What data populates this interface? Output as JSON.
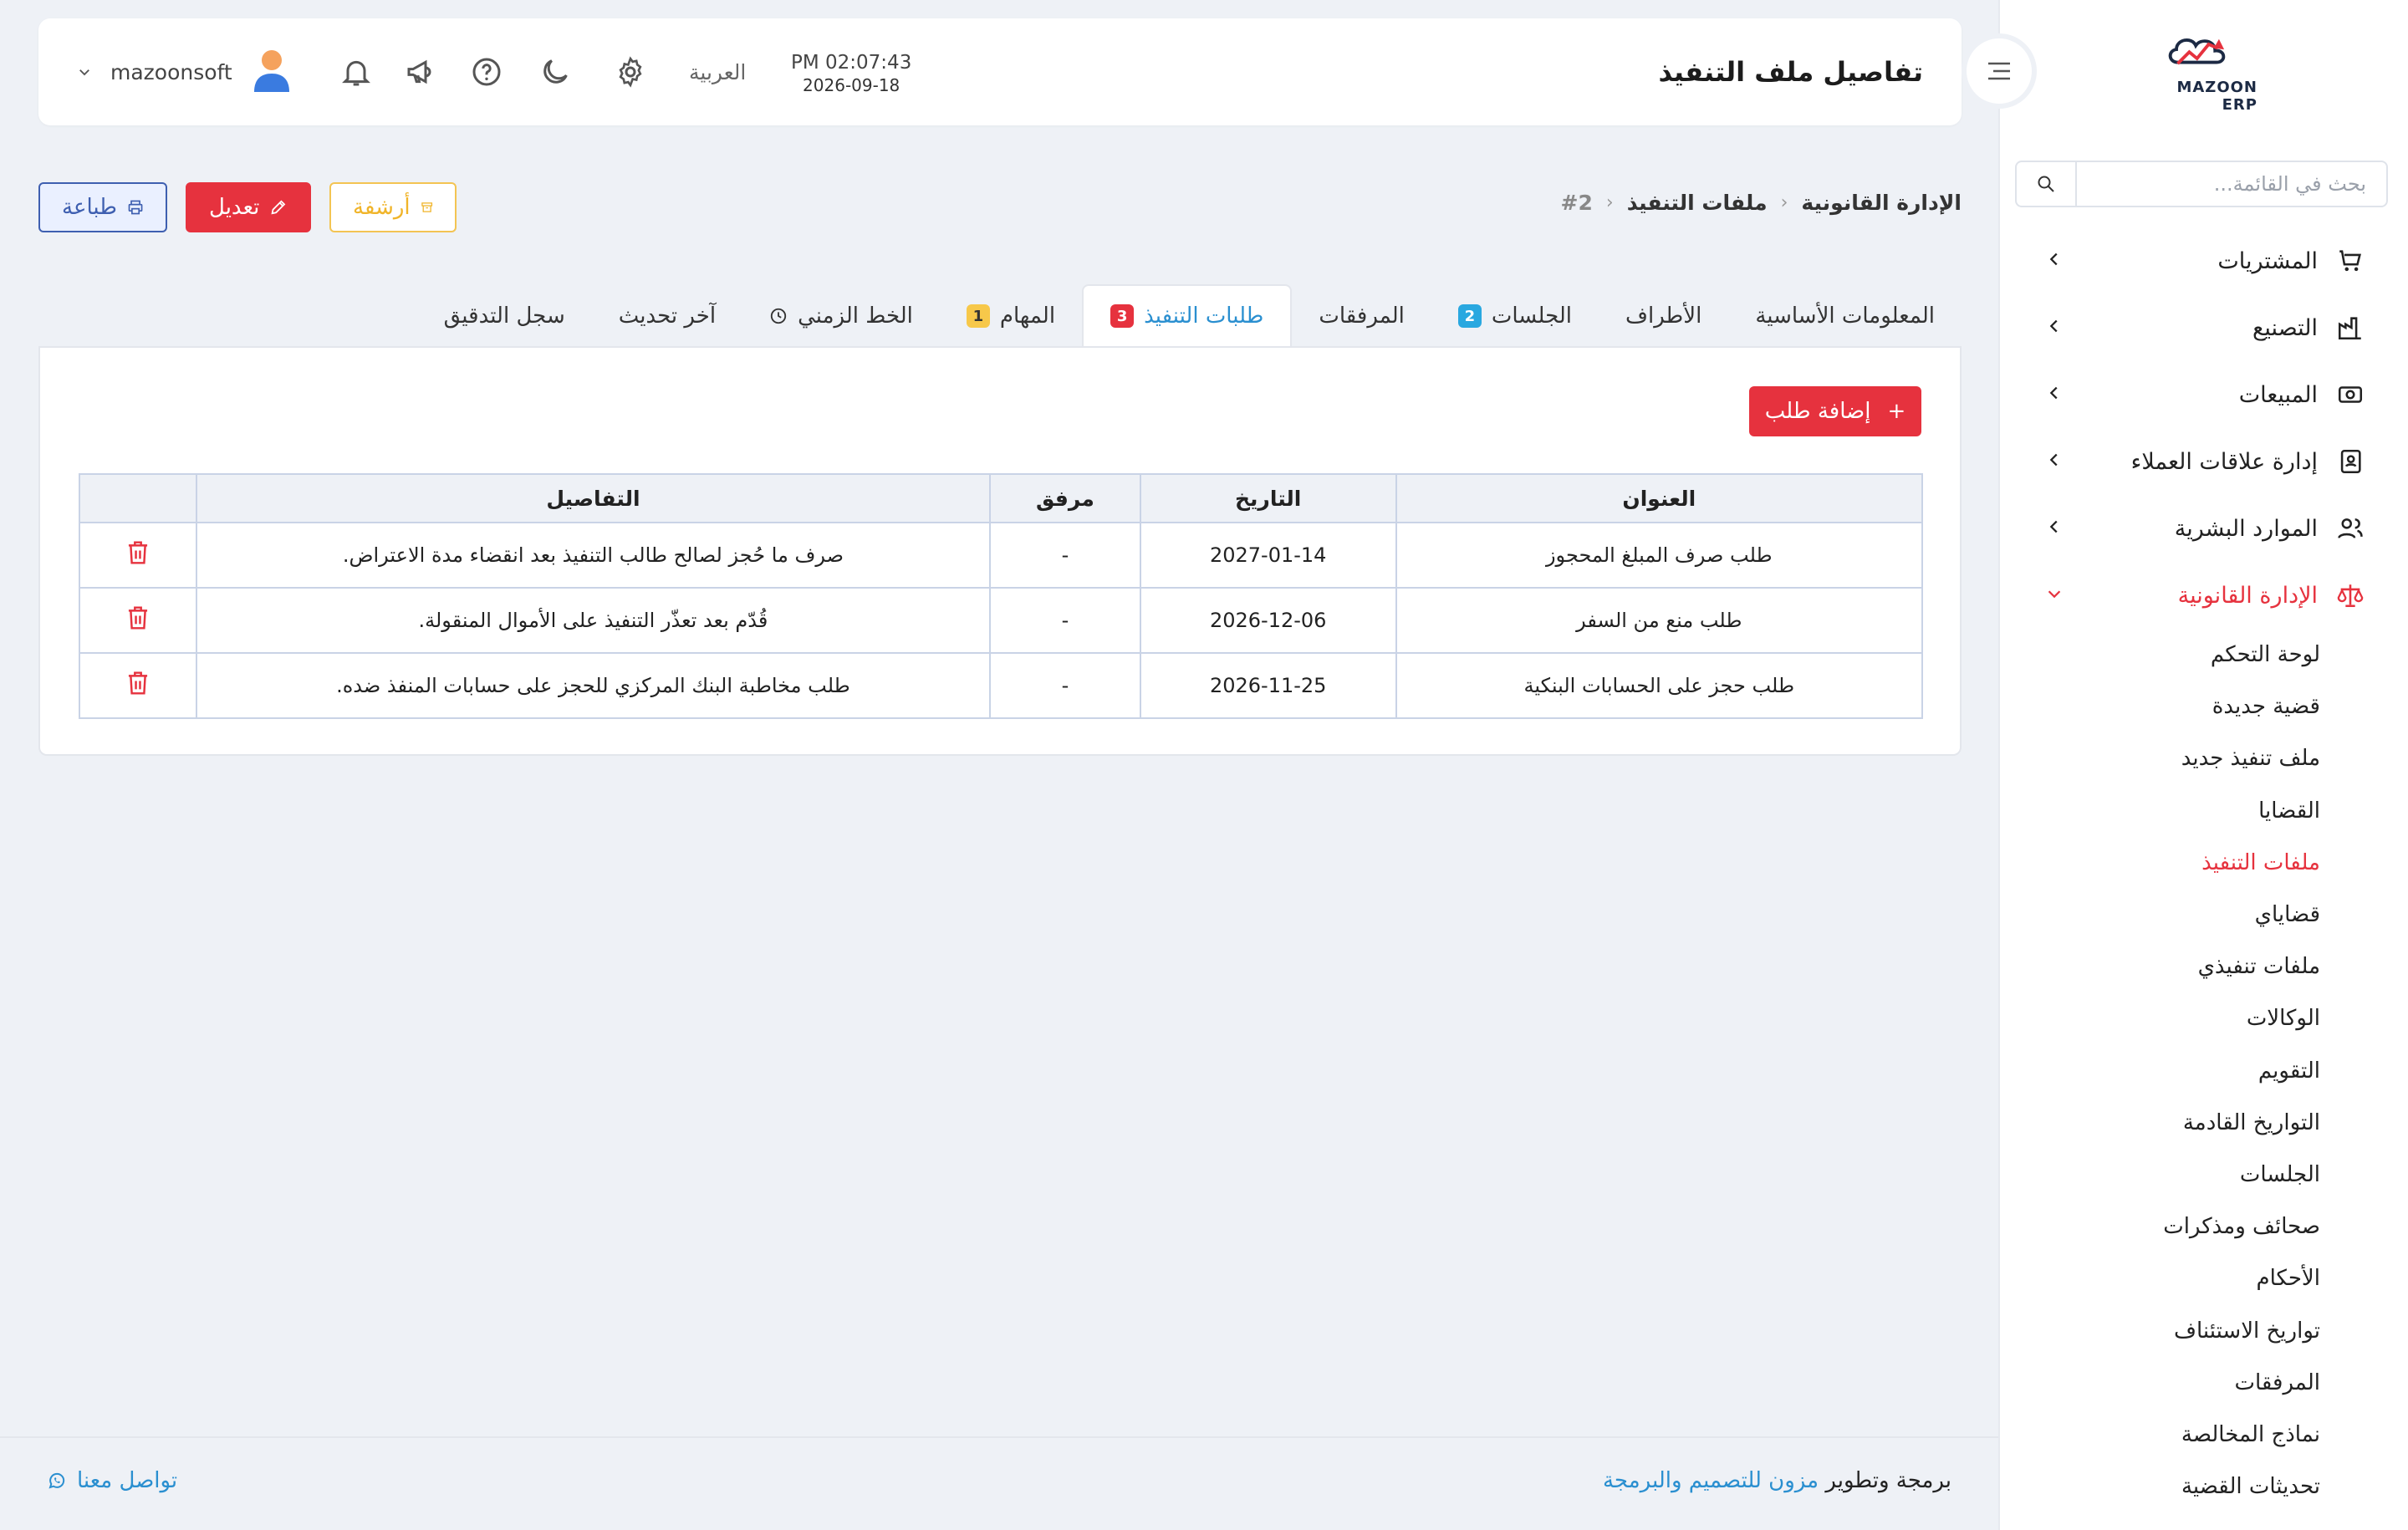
{
  "sidebar": {
    "logo_text": "MAZOON ERP",
    "search_placeholder": "بحث في القائمة...",
    "items": [
      {
        "label": "المشتريات"
      },
      {
        "label": "التصنيع"
      },
      {
        "label": "المبيعات"
      },
      {
        "label": "إدارة علاقات العملاء"
      },
      {
        "label": "الموارد البشرية"
      },
      {
        "label": "الإدارة القانونية"
      }
    ],
    "sub_items": [
      "لوحة التحكم",
      "قضية جديدة",
      "ملف تنفيذ جديد",
      "القضايا",
      "ملفات التنفيذ",
      "قضاياي",
      "ملفات تنفيذي",
      "الوكالات",
      "التقويم",
      "التواريخ القادمة",
      "الجلسات",
      "صحائف ومذكرات",
      "الأحكام",
      "تواريخ الاستئناف",
      "المرفقات",
      "نماذج المخالصة",
      "تحديثات القضية"
    ]
  },
  "header": {
    "title": "تفاصيل ملف التنفيذ",
    "time": "PM 02:07:43",
    "date": "2026-09-18",
    "language": "العربية",
    "username": "mazoonsoft"
  },
  "breadcrumb": {
    "root": "الإدارة القانونية",
    "parent": "ملفات التنفيذ",
    "current": "#2"
  },
  "actions": {
    "print": "طباعة",
    "edit": "تعديل",
    "archive": "أرشفة"
  },
  "tabs": [
    {
      "label": "المعلومات الأساسية"
    },
    {
      "label": "الأطراف"
    },
    {
      "label": "الجلسات",
      "badge": "2"
    },
    {
      "label": "المرفقات"
    },
    {
      "label": "طلبات التنفيذ",
      "badge": "3"
    },
    {
      "label": "المهام",
      "badge": "1"
    },
    {
      "label": "الخط الزمني"
    },
    {
      "label": "آخر تحديث"
    },
    {
      "label": "سجل التدقيق"
    }
  ],
  "requests": {
    "add_label": "إضافة طلب",
    "columns": {
      "title": "العنوان",
      "date": "التاريخ",
      "attachment": "مرفق",
      "details": "التفاصيل"
    },
    "rows": [
      {
        "title": "طلب صرف المبلغ المحجوز",
        "date": "2027-01-14",
        "attachment": "-",
        "details": "صرف ما حُجز لصالح طالب التنفيذ بعد انقضاء مدة الاعتراض."
      },
      {
        "title": "طلب منع من السفر",
        "date": "2026-12-06",
        "attachment": "-",
        "details": "قُدّم بعد تعذّر التنفيذ على الأموال المنقولة."
      },
      {
        "title": "طلب حجز على الحسابات البنكية",
        "date": "2026-11-25",
        "attachment": "-",
        "details": "طلب مخاطبة البنك المركزي للحجز على حسابات المنفذ ضده."
      }
    ]
  },
  "footer": {
    "prefix": "برمجة وتطوير",
    "company": "مزون للتصميم والبرمجة",
    "contact": "تواصل معنا"
  },
  "colors": {
    "accent": "#e6323e",
    "link": "#2a8fd0",
    "warning": "#f0b429",
    "print": "#3e5fb0",
    "badge_blue": "#29a8e0"
  }
}
